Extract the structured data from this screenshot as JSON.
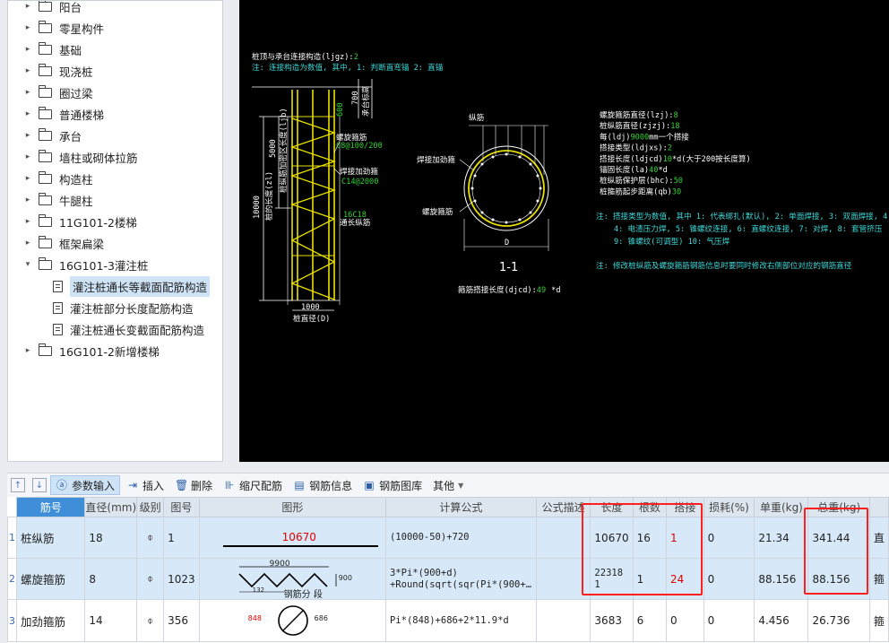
{
  "tree": {
    "items": [
      {
        "label": "阳台",
        "type": "folder",
        "expanded": false
      },
      {
        "label": "零星构件",
        "type": "folder",
        "expanded": false
      },
      {
        "label": "基础",
        "type": "folder",
        "expanded": false
      },
      {
        "label": "现浇桩",
        "type": "folder",
        "expanded": false
      },
      {
        "label": "圈过梁",
        "type": "folder",
        "expanded": false
      },
      {
        "label": "普通楼梯",
        "type": "folder",
        "expanded": false
      },
      {
        "label": "承台",
        "type": "folder",
        "expanded": false
      },
      {
        "label": "墙柱或砌体拉筋",
        "type": "folder",
        "expanded": false
      },
      {
        "label": "构造柱",
        "type": "folder",
        "expanded": false
      },
      {
        "label": "牛腿柱",
        "type": "folder",
        "expanded": false
      },
      {
        "label": "11G101-2楼梯",
        "type": "folder",
        "expanded": false
      },
      {
        "label": "框架扁梁",
        "type": "folder",
        "expanded": false
      },
      {
        "label": "16G101-3灌注桩",
        "type": "folder",
        "expanded": true
      },
      {
        "label": "灌注桩通长等截面配筋构造",
        "type": "doc",
        "selected": true
      },
      {
        "label": "灌注桩部分长度配筋构造",
        "type": "doc"
      },
      {
        "label": "灌注桩通长变截面配筋构造",
        "type": "doc"
      },
      {
        "label": "16G101-2新增楼梯",
        "type": "folder",
        "expanded": false
      }
    ]
  },
  "cad": {
    "top_title": "桩顶与承台连接构造(ljgz):",
    "top_title_val": "2",
    "top_note": "注: 连接构造为数值, 其中, 1: 判断直弯锚     2: 直锚",
    "dim_700": "700",
    "dim_pile_cap": "承台标高",
    "dim_5000": "5000",
    "label_5000_side": "桩纵筋加密区长度(ljb)",
    "dim_10000": "10000",
    "label_10000_side": "桩的长度(zl)",
    "label_spiral": "螺旋箍筋",
    "val_spiral": "C8@100/200",
    "label_stiff": "焊接加劲箍",
    "val_stiff": "C14@2000",
    "val_long": "16C18",
    "label_long": "通长纵筋",
    "dim_1000": "1000",
    "label_diameter": "桩直径(D)",
    "sec_longbar": "纵筋",
    "sec_stiff": "焊接加劲箍",
    "sec_spiral": "螺旋箍筋",
    "sec_D": "D",
    "sec_title": "1-1",
    "sec_lap": "箍筋搭接长度(djcd):",
    "sec_lap_val": "49",
    "sec_lap_unit": "*d",
    "params": [
      {
        "label": "螺旋箍筋直径(lzj):",
        "value": "8"
      },
      {
        "label": "桩纵筋直径(zjzj):",
        "value": "18"
      },
      {
        "label": "每(ldj)",
        "value": "9000",
        "suffix": "mm一个搭接"
      },
      {
        "label": "搭接类型(ldjxs):",
        "value": "2"
      },
      {
        "label": "搭接长度(ldjcd)",
        "value": "10",
        "suffix": "*d(大于200按长度算)"
      },
      {
        "label": "锚固长度(la)",
        "value": "40",
        "suffix": "*d"
      },
      {
        "label": "桩纵筋保护层(bhc):",
        "value": "50"
      },
      {
        "label": "桩箍筋起步距离(qb)",
        "value": "30"
      }
    ],
    "note_type_1": "注: 搭接类型为数值, 其中 1: 代表绑扎(默认), 2: 单面焊接, 3: 双面焊接, 4",
    "note_type_2": "4: 电渣压力焊, 5: 锥螺纹连接, 6: 直螺纹连接, 7: 对焊, 8: 套管挤压",
    "note_type_3": "9: 锥螺纹(可调型)  10: 气压焊",
    "note_modify": "注: 修改桩纵筋及螺旋箍筋钢筋信息时要同时修改右侧部位对应的钢筋直径"
  },
  "toolbar": {
    "up_icon": "↑",
    "down_icon": "↓",
    "param_input": "参数输入",
    "insert": "插入",
    "delete": "删除",
    "scale": "缩尺配筋",
    "rebar_info": "钢筋信息",
    "rebar_lib": "钢筋图库",
    "other": "其他"
  },
  "table": {
    "headers": [
      "筋号",
      "直径(mm)",
      "级别",
      "图号",
      "图形",
      "计算公式",
      "公式描述",
      "长度",
      "根数",
      "搭接",
      "损耗(%)",
      "单重(kg)",
      "总重(kg)"
    ],
    "rows": [
      {
        "num": "1",
        "name": "桩纵筋",
        "dia": "18",
        "grade": "⌽",
        "fig": "1",
        "shape_len": "10670",
        "formula_1": "(10000-50)+720",
        "formula_2": "",
        "desc": "",
        "length": "10670",
        "count": "16",
        "lap": "1",
        "loss": "0",
        "unit_w": "21.34",
        "total_w": "341.44",
        "extra": "直"
      },
      {
        "num": "2",
        "name": "螺旋箍筋",
        "dia": "8",
        "grade": "⌽",
        "fig": "1023",
        "shape_w": "9900",
        "shape_h": "900",
        "shape_small": "132",
        "shape_note": "钢筋分 段",
        "formula_1": "3*Pi*(900+d)",
        "formula_2": "+Round(sqrt(sqr(Pi*(900+…",
        "desc": "",
        "length": "22318",
        "length_2": "1",
        "count": "1",
        "lap": "24",
        "loss": "0",
        "unit_w": "88.156",
        "total_w": "88.156",
        "extra": "箍"
      },
      {
        "num": "3",
        "name": "加劲箍筋",
        "dia": "14",
        "grade": "⌽",
        "fig": "356",
        "shape_a": "848",
        "shape_b": "686",
        "formula_1": "Pi*(848)+686+2*11.9*d",
        "formula_2": "",
        "desc": "",
        "length": "3683",
        "count": "6",
        "lap": "0",
        "loss": "0",
        "unit_w": "4.456",
        "total_w": "26.736",
        "extra": "箍"
      }
    ]
  }
}
